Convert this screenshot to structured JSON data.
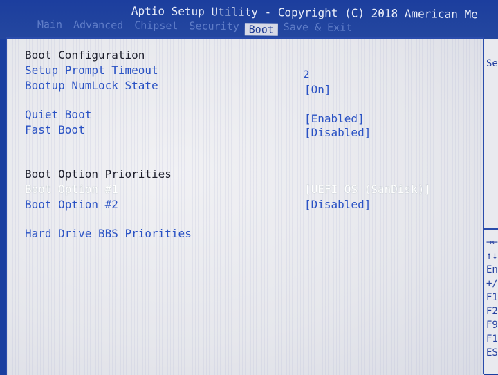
{
  "header": {
    "title": "Aptio Setup Utility - Copyright (C) 2018 American Me",
    "tabs": [
      "Main",
      "Advanced",
      "Chipset",
      "Security",
      "Boot",
      "Save & Exit"
    ],
    "active_tab": "Boot"
  },
  "boot": {
    "config_heading": "Boot Configuration",
    "setup_prompt_timeout_label": "Setup Prompt Timeout",
    "setup_prompt_timeout_value": "2",
    "bootup_numlock_label": "Bootup NumLock State",
    "bootup_numlock_value": "[On]",
    "quiet_boot_label": "Quiet Boot",
    "quiet_boot_value": "[Enabled]",
    "fast_boot_label": "Fast Boot",
    "fast_boot_value": "[Disabled]",
    "priorities_heading": "Boot Option Priorities",
    "boot_option_1_label": "Boot Option #1",
    "boot_option_1_value": "[UEFI OS (SanDisk)]",
    "boot_option_2_label": "Boot Option #2",
    "boot_option_2_value": "[Disabled]",
    "hdd_bbs_label": "Hard Drive BBS Priorities"
  },
  "help_panel": {
    "top_text": "Se",
    "keys": [
      "→←",
      "↑↓",
      "En",
      "+/",
      "F1",
      "F2",
      "F9",
      "F1",
      "ES"
    ]
  },
  "colors": {
    "bios_blue": "#1a3fa0",
    "panel_gray": "#e9eaef",
    "item_blue": "#2a52c4",
    "selected_white": "#ffffff"
  }
}
